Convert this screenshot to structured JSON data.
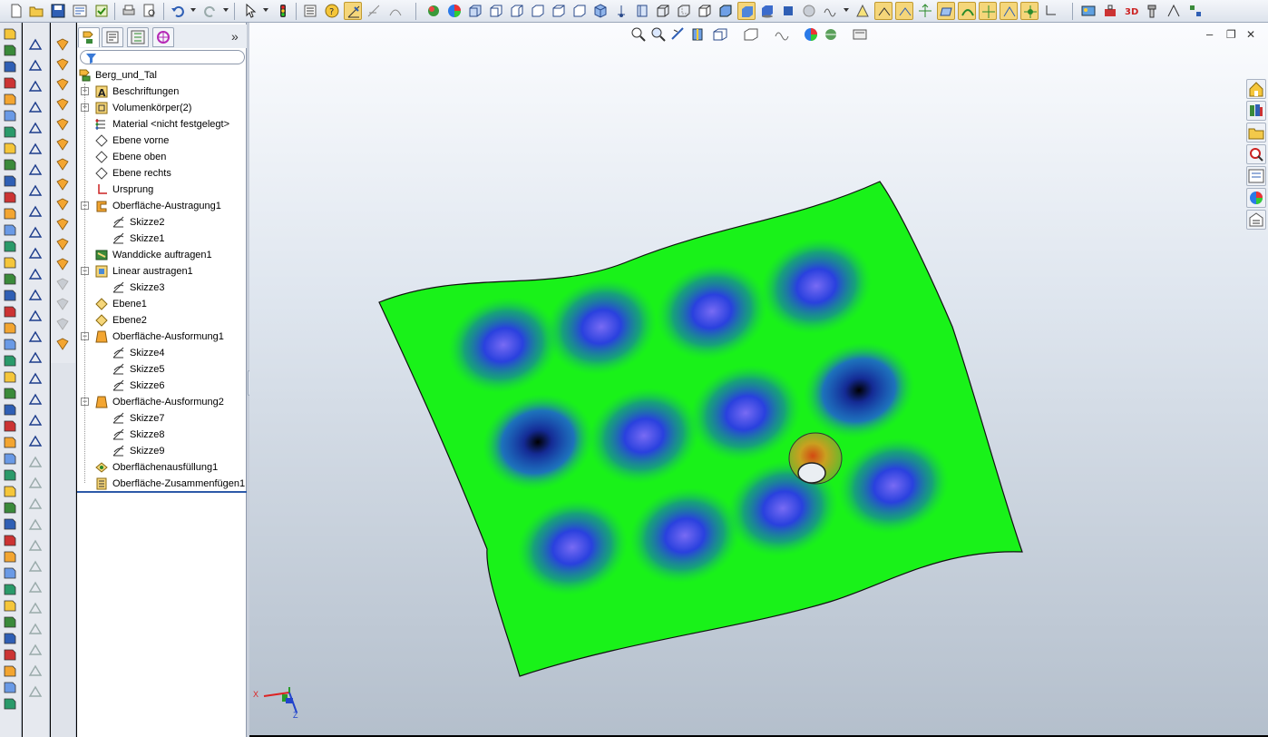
{
  "feature_tree": {
    "root": "Berg_und_Tal",
    "items": [
      {
        "label": "Beschriftungen",
        "expand": "+"
      },
      {
        "label": "Volumenkörper(2)",
        "expand": "+"
      },
      {
        "label": "Material <nicht festgelegt>"
      },
      {
        "label": "Ebene vorne"
      },
      {
        "label": "Ebene oben"
      },
      {
        "label": "Ebene rechts"
      },
      {
        "label": "Ursprung"
      },
      {
        "label": "Oberfläche-Austragung1",
        "expand": "−"
      },
      {
        "label": "Skizze2",
        "child": true
      },
      {
        "label": "Skizze1",
        "child": true
      },
      {
        "label": "Wanddicke auftragen1"
      },
      {
        "label": "Linear austragen1",
        "expand": "−"
      },
      {
        "label": "Skizze3",
        "child": true
      },
      {
        "label": "Ebene1"
      },
      {
        "label": "Ebene2"
      },
      {
        "label": "Oberfläche-Ausformung1",
        "expand": "−"
      },
      {
        "label": "Skizze4",
        "child": true
      },
      {
        "label": "Skizze5",
        "child": true
      },
      {
        "label": "Skizze6",
        "child": true
      },
      {
        "label": "Oberfläche-Ausformung2",
        "expand": "−"
      },
      {
        "label": "Skizze7",
        "child": true
      },
      {
        "label": "Skizze8",
        "child": true
      },
      {
        "label": "Skizze9",
        "child": true
      },
      {
        "label": "Oberflächenausfüllung1"
      },
      {
        "label": "Oberfläche-Zusammenfügen1"
      }
    ]
  },
  "panel": {
    "collapse_glyph": "»",
    "expand_plus": "+",
    "expand_minus": "−"
  },
  "triad": {
    "x": "X",
    "z": "Z"
  },
  "window_controls": {
    "minimize": "–",
    "restore": "❐",
    "close": "✕"
  },
  "colors": {
    "surface": "#19f219",
    "valley": "#1f3cff",
    "accent": "#f5d67a"
  }
}
